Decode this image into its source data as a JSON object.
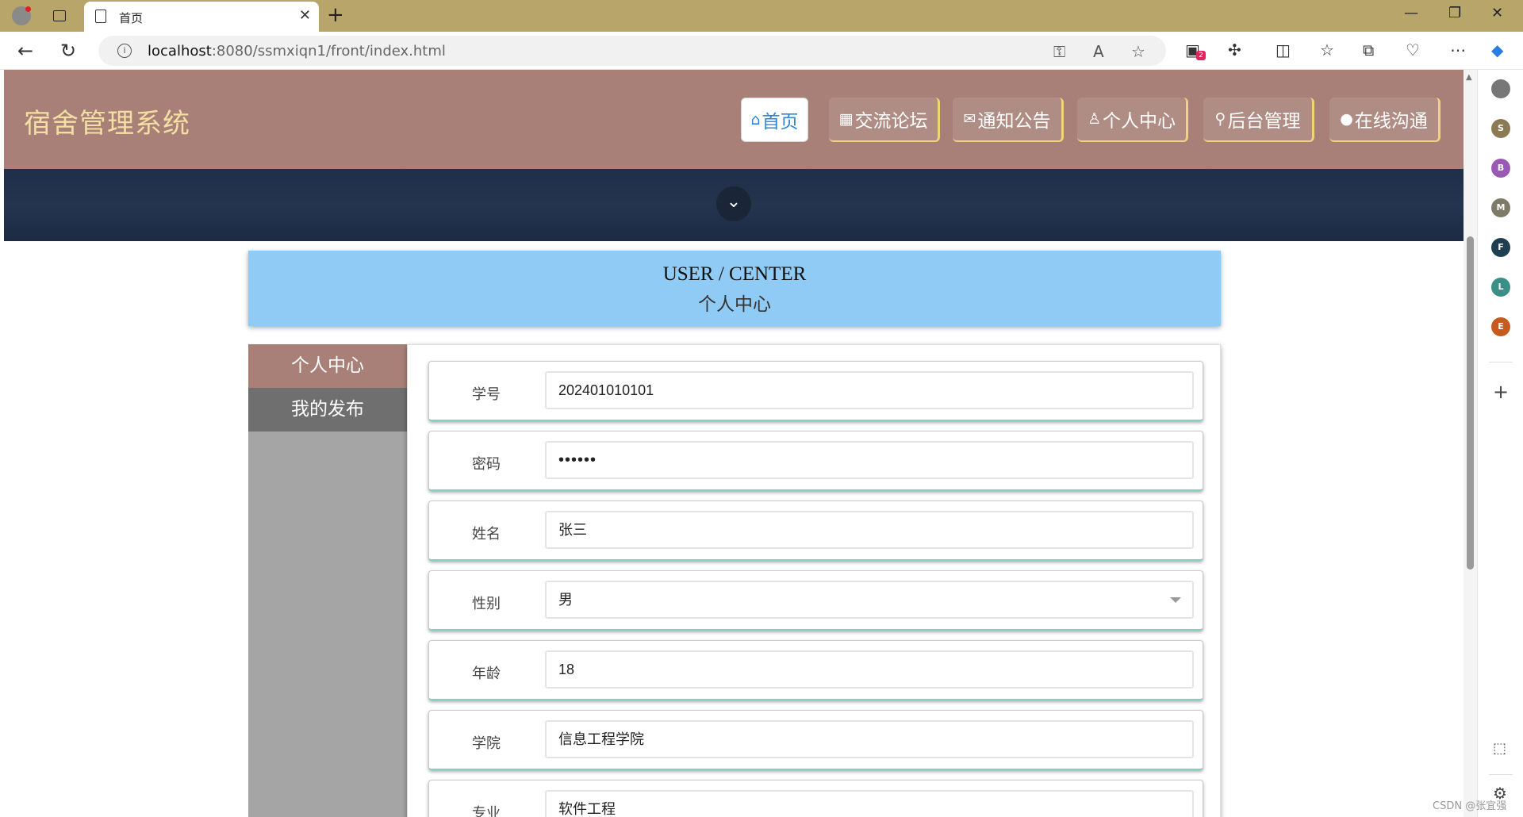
{
  "browser": {
    "tab_title": "首页",
    "url_host": "localhost",
    "url_rest": ":8080/ssmxiqn1/front/index.html",
    "badge_count": "2"
  },
  "sidebar_profiles": [
    {
      "letter": "S",
      "color": "#8c7a52"
    },
    {
      "letter": "B",
      "color": "#9b59b6"
    },
    {
      "letter": "M",
      "color": "#7d7a66"
    },
    {
      "letter": "F",
      "color": "#1f3e4f"
    },
    {
      "letter": "L",
      "color": "#3a8f86"
    },
    {
      "letter": "E",
      "color": "#c75b1e"
    }
  ],
  "site": {
    "logo": "宿舍管理系统",
    "nav": [
      {
        "label": "首页",
        "icon": "⌂"
      },
      {
        "label": "交流论坛",
        "icon": "▦"
      },
      {
        "label": "通知公告",
        "icon": "✉"
      },
      {
        "label": "个人中心",
        "icon": "♙"
      },
      {
        "label": "后台管理",
        "icon": "⚲"
      },
      {
        "label": "在线沟通",
        "icon": "●"
      }
    ]
  },
  "title": {
    "en": "USER / CENTER",
    "zh": "个人中心"
  },
  "menu": {
    "items": [
      "个人中心",
      "我的发布"
    ]
  },
  "form": {
    "fields": [
      {
        "label": "学号",
        "value": "202401010101"
      },
      {
        "label": "密码",
        "value": "••••••"
      },
      {
        "label": "姓名",
        "value": "张三"
      },
      {
        "label": "性别",
        "value": "男"
      },
      {
        "label": "年龄",
        "value": "18"
      },
      {
        "label": "学院",
        "value": "信息工程学院"
      },
      {
        "label": "专业",
        "value": "软件工程"
      }
    ]
  },
  "watermark": "CSDN @张宜强"
}
